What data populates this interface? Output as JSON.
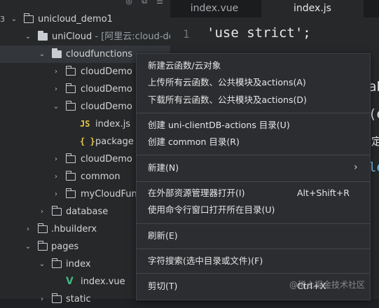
{
  "explorer": {
    "head_icons": [
      "target-icon",
      "collapse-icon",
      "menu-icon"
    ],
    "edge_fragment": "3",
    "tree": [
      {
        "label": "unicloud_demo1",
        "chevron": "down",
        "icon": "folder-outline"
      },
      {
        "label": "uniCloud",
        "sub": " - [阿里云:cloud-dem",
        "chevron": "down",
        "icon": "folder-filled"
      },
      {
        "label": "cloudfunctions",
        "chevron": "down",
        "icon": "folder-filled"
      },
      {
        "label": "cloudDemo",
        "chevron": "right",
        "icon": "folder-outline"
      },
      {
        "label": "cloudDemo",
        "chevron": "right",
        "icon": "folder-outline"
      },
      {
        "label": "cloudDemo",
        "chevron": "down",
        "icon": "folder-outline"
      },
      {
        "label": "index.js",
        "chevron": "",
        "icon": "js"
      },
      {
        "label": "package",
        "chevron": "",
        "icon": "json"
      },
      {
        "label": "cloudDemo",
        "chevron": "right",
        "icon": "folder-outline"
      },
      {
        "label": "common",
        "chevron": "right",
        "icon": "folder-outline"
      },
      {
        "label": "myCloudFun",
        "chevron": "right",
        "icon": "folder-outline"
      },
      {
        "label": "database",
        "chevron": "right",
        "icon": "folder-outline"
      },
      {
        "label": ".hbuilderx",
        "chevron": "right",
        "icon": "folder-outline"
      },
      {
        "label": "pages",
        "chevron": "down",
        "icon": "folder-outline"
      },
      {
        "label": "index",
        "chevron": "down",
        "icon": "folder-outline"
      },
      {
        "label": "index.vue",
        "chevron": "",
        "icon": "vue"
      },
      {
        "label": "static",
        "chevron": "right",
        "icon": "folder-outline"
      }
    ]
  },
  "editor": {
    "tabs": [
      {
        "label": "index.vue",
        "active": false
      },
      {
        "label": "index.js",
        "active": true
      }
    ],
    "line_number": "1",
    "code_line": "'use strict';",
    "fragments": [
      "ab",
      "(e",
      "定",
      "le"
    ]
  },
  "context_menu": {
    "items": [
      {
        "label": "新建云函数/云对象"
      },
      {
        "label": "上传所有云函数、公共模块及actions(A)"
      },
      {
        "label": "下载所有云函数、公共模块及actions(D)"
      },
      {
        "label": "创建 uni-clientDB-actions 目录(U)"
      },
      {
        "label": "创建 common 目录(R)"
      },
      {
        "label": "新建(N)",
        "submenu": true
      },
      {
        "label": "在外部资源管理器打开(I)",
        "shortcut": "Alt+Shift+R"
      },
      {
        "label": "使用命令行窗口打开所在目录(U)"
      },
      {
        "label": "刷新(E)"
      },
      {
        "label": "字符搜索(选中目录或文件)(F)"
      },
      {
        "label": "剪切(T)",
        "shortcut": "Ctrl+X"
      }
    ]
  },
  "watermark": "@稀土掘金技术社区",
  "colors": {
    "background": "#202124",
    "explorer_bg": "#26282a",
    "menu_bg": "#2b2d30",
    "string_color": "#d9c06a",
    "js_icon": "#e8c54e",
    "vue_icon": "#41b883"
  }
}
